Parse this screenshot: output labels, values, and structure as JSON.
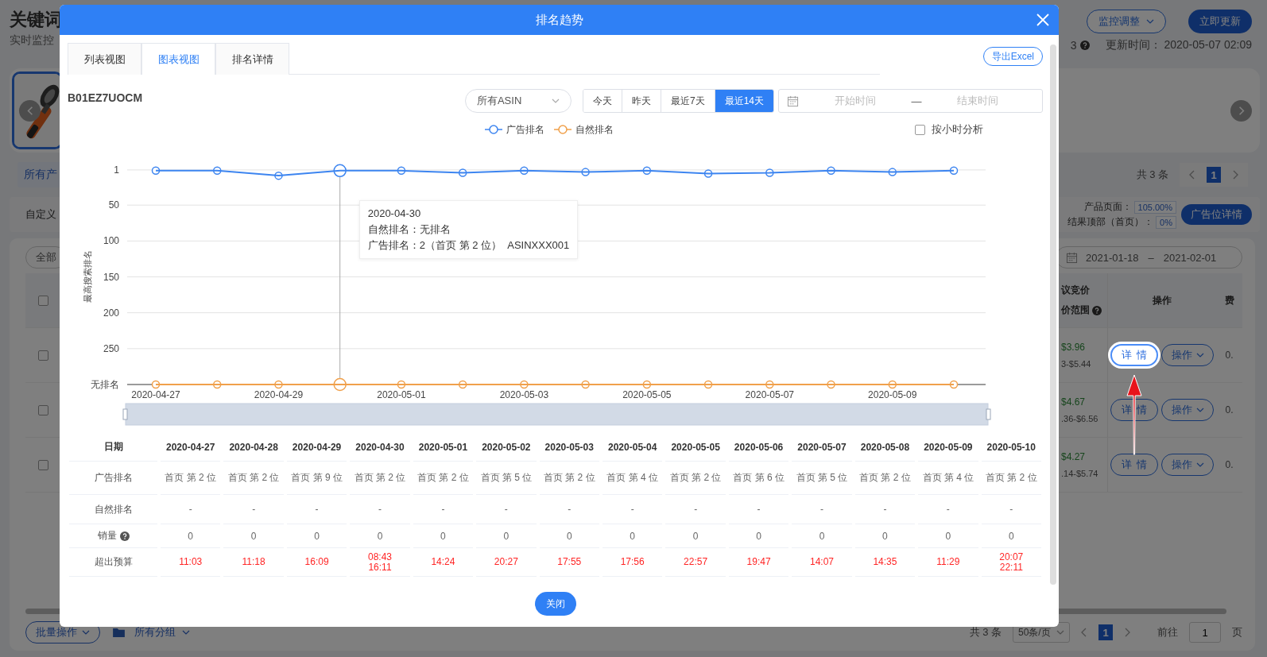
{
  "page": {
    "title": "关键词",
    "subtitle": "实时监控",
    "count_fragment": "3",
    "monitor_button": "监控调整",
    "update_button": "立即更新",
    "update_time": "更新时间： 2020-05-07 02:09",
    "product_tab": "所有产",
    "total": "共 3 条",
    "pager_current": "1",
    "custom_label": "自定义",
    "placement_stats": [
      {
        "label": "产品页面：",
        "value": "105.00%"
      },
      {
        "label": "结果顶部（首页）：",
        "value": "0%"
      }
    ],
    "placement_button": "广告位详情",
    "filter_pill": "全部",
    "date_range": {
      "start": "2021-01-18",
      "separator": "–",
      "end": "2021-02-01"
    },
    "table": {
      "header_checked": false,
      "bid_title": "议竞价",
      "bid_range_title": "价范围",
      "actions_title": "操作",
      "cut_title": "费",
      "rows": [
        {
          "checked": false,
          "bid": "$3.96",
          "bid_range": "3-$5.44",
          "detail_button": "详情",
          "highlighted": true,
          "action_button": "操作",
          "cut_value": "0."
        },
        {
          "checked": false,
          "bid": "$4.67",
          "bid_range": ".36-$6.56",
          "detail_button": "详情",
          "highlighted": false,
          "action_button": "操作",
          "cut_value": "0."
        },
        {
          "checked": false,
          "bid": "$4.27",
          "bid_range": ".14-$5.74",
          "detail_button": "详情",
          "highlighted": false,
          "action_button": "操作",
          "cut_value": "0."
        }
      ]
    },
    "footer": {
      "batch_button": "批量操作",
      "group_select": "所有分组",
      "total": "共 3 条",
      "page_size": "50条/页",
      "page": "1",
      "goto": "前往",
      "goto_value": "1",
      "page_unit": "页"
    }
  },
  "modal": {
    "title": "排名趋势",
    "tabs": [
      {
        "label": "列表视图",
        "selected": false
      },
      {
        "label": "图表视图",
        "selected": true
      },
      {
        "label": "排名详情",
        "selected": false
      }
    ],
    "export_button": "导出Excel",
    "asin": "B01EZ7UOCM",
    "asin_select": "所有ASIN",
    "ranges": [
      {
        "label": "今天",
        "selected": false
      },
      {
        "label": "昨天",
        "selected": false
      },
      {
        "label": "最近7天",
        "selected": false
      },
      {
        "label": "最近14天",
        "selected": true
      }
    ],
    "date_range": {
      "start_placeholder": "开始时间",
      "separator": "—",
      "end_placeholder": "结束时间"
    },
    "hourly": {
      "label": "按小时分析",
      "checked": false
    },
    "chart_data": {
      "type": "line",
      "ylabel": "最高搜索排名",
      "categories": [
        "2020-04-27",
        null,
        "2020-04-29",
        null,
        "2020-05-01",
        null,
        "2020-05-03",
        null,
        "2020-05-05",
        null,
        "2020-05-07",
        null,
        "2020-05-09",
        null
      ],
      "ylim": [
        300,
        0
      ],
      "grid": true,
      "yticks": [
        1,
        50,
        100,
        150,
        200,
        250,
        {
          "value": 300,
          "label": "无排名"
        }
      ],
      "series": [
        {
          "name": "广告排名",
          "color": "#3d85f0",
          "marker": "circle",
          "values": [
            2,
            2,
            9,
            2,
            2,
            5,
            2,
            4,
            2,
            6,
            5,
            2,
            4,
            2
          ]
        },
        {
          "name": "自然排名",
          "color": "#f0a04b",
          "marker": "circle",
          "values": [
            300,
            300,
            300,
            300,
            300,
            300,
            300,
            300,
            300,
            300,
            300,
            300,
            300,
            300
          ]
        }
      ]
    },
    "tooltip": {
      "title": "2020-04-30",
      "lines": [
        "自然排名：无排名",
        "广告排名：2（首页 第 2 位）  ASINXXX001"
      ]
    },
    "table": {
      "labels": {
        "date": "日期",
        "ad_rank": "广告排名",
        "organic_rank": "自然排名",
        "sales": "销量",
        "over_budget": "超出预算"
      },
      "columns": [
        {
          "date": "2020-04-27",
          "ad_rank": "首页 第 2 位",
          "organic_rank": "-",
          "sales": "0",
          "over_budget": [
            "11:03"
          ]
        },
        {
          "date": "2020-04-28",
          "ad_rank": "首页 第 2 位",
          "organic_rank": "-",
          "sales": "0",
          "over_budget": [
            "11:18"
          ]
        },
        {
          "date": "2020-04-29",
          "ad_rank": "首页 第 9 位",
          "organic_rank": "-",
          "sales": "0",
          "over_budget": [
            "16:09"
          ]
        },
        {
          "date": "2020-04-30",
          "ad_rank": "首页 第 2 位",
          "organic_rank": "-",
          "sales": "0",
          "over_budget": [
            "08:43",
            "16:11"
          ]
        },
        {
          "date": "2020-05-01",
          "ad_rank": "首页 第 2 位",
          "organic_rank": "-",
          "sales": "0",
          "over_budget": [
            "14:24"
          ]
        },
        {
          "date": "2020-05-02",
          "ad_rank": "首页 第 5 位",
          "organic_rank": "-",
          "sales": "0",
          "over_budget": [
            "20:27"
          ]
        },
        {
          "date": "2020-05-03",
          "ad_rank": "首页 第 2 位",
          "organic_rank": "-",
          "sales": "0",
          "over_budget": [
            "17:55"
          ]
        },
        {
          "date": "2020-05-04",
          "ad_rank": "首页 第 4 位",
          "organic_rank": "-",
          "sales": "0",
          "over_budget": [
            "17:56"
          ]
        },
        {
          "date": "2020-05-05",
          "ad_rank": "首页 第 2 位",
          "organic_rank": "-",
          "sales": "0",
          "over_budget": [
            "22:57"
          ]
        },
        {
          "date": "2020-05-06",
          "ad_rank": "首页 第 6 位",
          "organic_rank": "-",
          "sales": "0",
          "over_budget": [
            "19:47"
          ]
        },
        {
          "date": "2020-05-07",
          "ad_rank": "首页 第 5 位",
          "organic_rank": "-",
          "sales": "0",
          "over_budget": [
            "14:07"
          ]
        },
        {
          "date": "2020-05-08",
          "ad_rank": "首页 第 2 位",
          "organic_rank": "-",
          "sales": "0",
          "over_budget": [
            "14:35"
          ]
        },
        {
          "date": "2020-05-09",
          "ad_rank": "首页 第 4 位",
          "organic_rank": "-",
          "sales": "0",
          "over_budget": [
            "11:29"
          ]
        },
        {
          "date": "2020-05-10",
          "ad_rank": "首页 第 2 位",
          "organic_rank": "-",
          "sales": "0",
          "over_budget": [
            "20:07",
            "22:11"
          ]
        }
      ]
    },
    "close_button": "关闭"
  }
}
